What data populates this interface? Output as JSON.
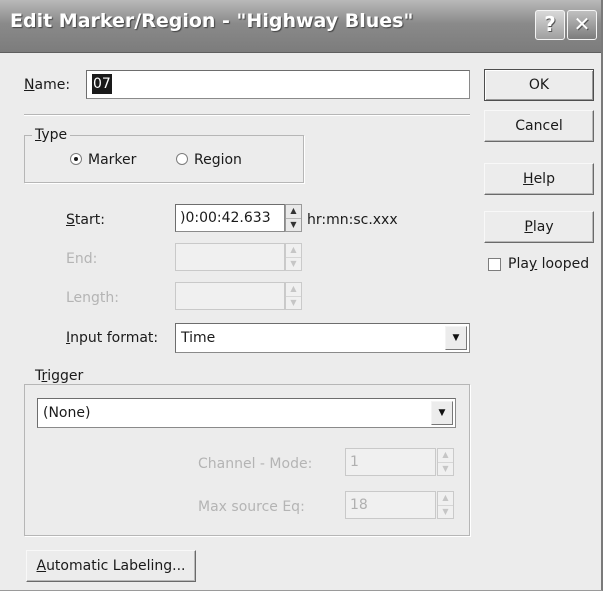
{
  "window": {
    "title": "Edit Marker/Region - \"Highway Blues\"",
    "help_glyph": "?",
    "close_glyph": "✕"
  },
  "name": {
    "label_u": "N",
    "label_rest": "ame:",
    "value": "07"
  },
  "type_group": {
    "title_u": "T",
    "title_rest": "ype",
    "marker_label": "Marker",
    "region_label": "Region",
    "selected": "Marker"
  },
  "start": {
    "label_u": "S",
    "label_rest": "tart:",
    "value": ")0:00:42.633",
    "units": "hr:mn:sc.xxx"
  },
  "end": {
    "label": "End:",
    "value": ""
  },
  "length": {
    "label": "Length:",
    "value": ""
  },
  "input_format": {
    "label_u": "I",
    "label_rest": "nput format:",
    "value": "Time"
  },
  "trigger_group": {
    "title_pre": "T",
    "title_u": "r",
    "title_rest": "igger",
    "selected": "(None)",
    "channel_label": "Channel - Mode:",
    "channel_value": "1",
    "max_label": "Max source Eq:",
    "max_value": "18"
  },
  "buttons": {
    "ok": "OK",
    "cancel": "Cancel",
    "help_u": "H",
    "help_rest": "elp",
    "play_u": "P",
    "play_rest": "lay",
    "auto_label_u": "A",
    "auto_label_rest": "utomatic Labeling..."
  },
  "play_looped": {
    "pre": "Pla",
    "u": "y",
    "rest": " looped",
    "checked": false
  }
}
